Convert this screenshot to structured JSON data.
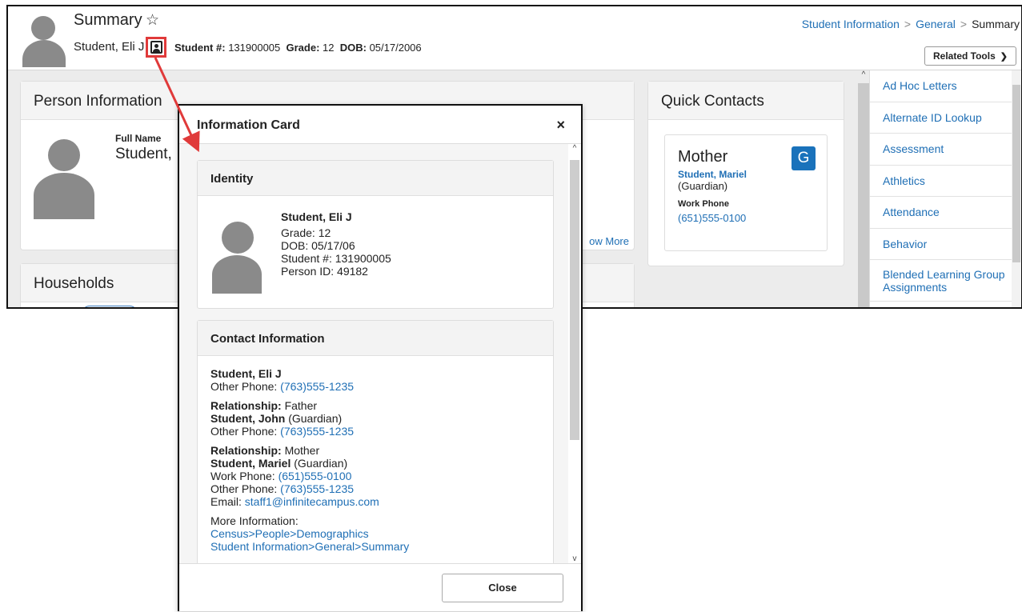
{
  "header": {
    "title": "Summary",
    "student_name": "Student, Eli J",
    "student_number_label": "Student #:",
    "student_number": "131900005",
    "grade_label": "Grade:",
    "grade": "12",
    "dob_label": "DOB:",
    "dob": "05/17/2006",
    "breadcrumb": [
      "Student Information",
      "General",
      "Summary"
    ],
    "related_tools_label": "Related Tools"
  },
  "person_info": {
    "title": "Person Information",
    "full_name_label": "Full Name",
    "full_name_value": "Student,",
    "show_more": "ow More"
  },
  "households": {
    "title": "Households"
  },
  "quick_contacts": {
    "title": "Quick Contacts",
    "card": {
      "role": "Mother",
      "name": "Student, Mariel",
      "relationship": "(Guardian)",
      "phone_label": "Work Phone",
      "phone": "(651)555-0100",
      "badge": "G"
    }
  },
  "related_tools": {
    "items": [
      "Ad Hoc Letters",
      "Alternate ID Lookup",
      "Assessment",
      "Athletics",
      "Attendance",
      "Behavior",
      "Blended Learning Group Assignments"
    ]
  },
  "modal": {
    "title": "Information Card",
    "close_x": "×",
    "close_button": "Close",
    "identity": {
      "title": "Identity",
      "name": "Student, Eli J",
      "grade": "Grade: 12",
      "dob": "DOB: 05/17/06",
      "student_number": "Student #: 131900005",
      "person_id": "Person ID: 49182"
    },
    "contact": {
      "title": "Contact Information",
      "self_name": "Student, Eli J",
      "other_phone_label": "Other Phone:",
      "self_other_phone": "(763)555-1235",
      "relationship_label": "Relationship:",
      "father_rel": "Father",
      "father_name": "Student, John",
      "father_guardian": "(Guardian)",
      "father_other_phone": "(763)555-1235",
      "mother_rel": "Mother",
      "mother_name": "Student, Mariel",
      "mother_guardian": "(Guardian)",
      "work_phone_label": "Work Phone:",
      "mother_work_phone": "(651)555-0100",
      "mother_other_phone": "(763)555-1235",
      "email_label": "Email:",
      "mother_email": "staff1@infinitecampus.com",
      "more_info_label": "More Information:",
      "more_info_links": [
        "Census>People>Demographics",
        "Student Information>General>Summary"
      ]
    }
  },
  "colors": {
    "link": "#1f6fb5",
    "highlight": "#e03a3a",
    "badge": "#1a72bb"
  }
}
